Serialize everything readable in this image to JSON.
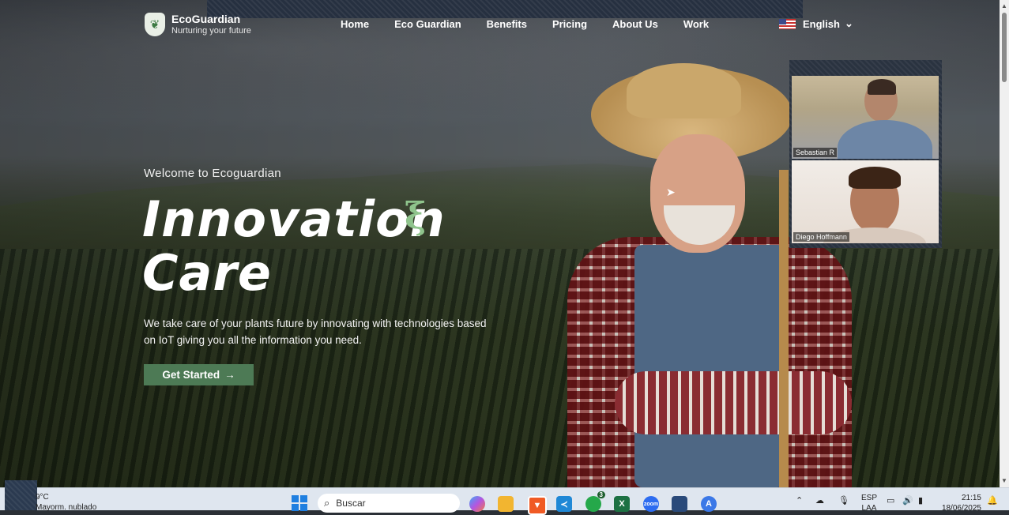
{
  "brand": {
    "name": "EcoGuardian",
    "tagline": "Nurturing your future"
  },
  "nav": [
    "Home",
    "Eco Guardian",
    "Benefits",
    "Pricing",
    "About Us",
    "Work"
  ],
  "language": {
    "label": "English"
  },
  "hero": {
    "welcome": "Welcome to Ecoguardian",
    "headline_line1": "Innovation",
    "headline_line2": "Care",
    "squiggle": "ξ",
    "subtitle": "We take care of your plants future by innovating with technologies based on IoT giving you all the information you need.",
    "cta_label": "Get Started",
    "cta_arrow": "→"
  },
  "video_call": {
    "participants": [
      {
        "name": "Sebastian R"
      },
      {
        "name": "Diego Hoffmann"
      }
    ]
  },
  "taskbar": {
    "weather_temp": "9°C",
    "weather_desc": "Mayorm. nublado",
    "search_placeholder": "Buscar",
    "whatsapp_badge": "3",
    "lang_code": "ESP",
    "lang_region": "LAA",
    "time": "21:15",
    "date": "18/06/2025"
  },
  "colors": {
    "cta": "#4d7a55",
    "accent_squiggle": "#8fc48c",
    "taskbar": "#dfe6ef"
  }
}
